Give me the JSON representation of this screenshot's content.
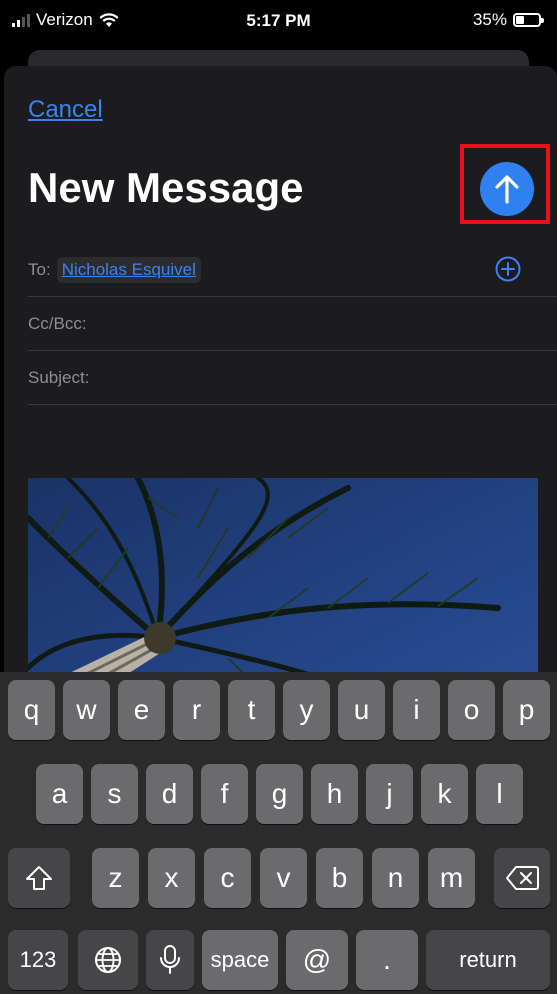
{
  "status_bar": {
    "carrier": "Verizon",
    "time": "5:17 PM",
    "battery_percent_label": "35%",
    "battery_level": 0.35,
    "signal_bars": 2
  },
  "compose": {
    "cancel_label": "Cancel",
    "title": "New Message",
    "to_label": "To:",
    "recipient": "Nicholas Esquivel",
    "cc_label": "Cc/Bcc:",
    "subject_label": "Subject:"
  },
  "keyboard": {
    "row1": [
      "q",
      "w",
      "e",
      "r",
      "t",
      "y",
      "u",
      "i",
      "o",
      "p"
    ],
    "row2": [
      "a",
      "s",
      "d",
      "f",
      "g",
      "h",
      "j",
      "k",
      "l"
    ],
    "row3": [
      "z",
      "x",
      "c",
      "v",
      "b",
      "n",
      "m"
    ],
    "numbers_label": "123",
    "space_label": "space",
    "at_label": "@",
    "period_label": ".",
    "return_label": "return"
  },
  "icons": {
    "send": "arrow-up-icon",
    "add_contact": "plus-circle-icon",
    "shift": "shift-icon",
    "delete": "backspace-icon",
    "globe": "globe-icon",
    "mic": "microphone-icon",
    "wifi": "wifi-icon"
  },
  "colors": {
    "accent": "#3a82f7",
    "send_button": "#2f80f0",
    "highlight": "#e8101a",
    "sheet": "#1c1c1e"
  }
}
